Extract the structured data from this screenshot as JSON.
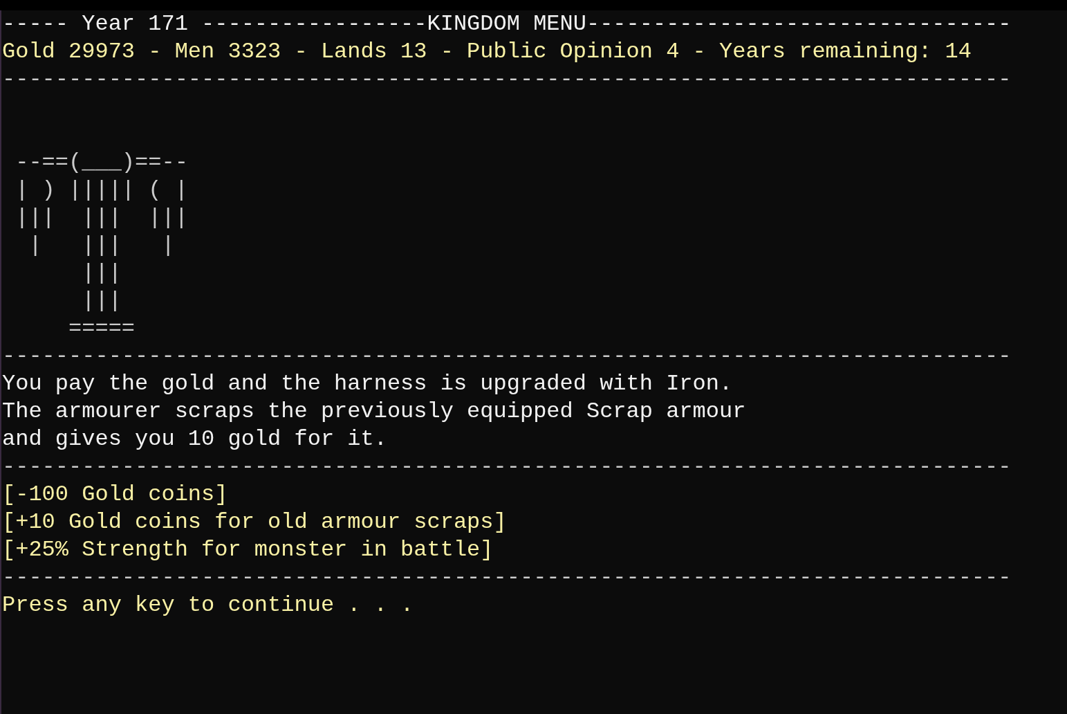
{
  "console": {
    "lines": [
      {
        "kind": "heading",
        "text": "----- Year 171 -----------------KINGDOM MENU--------------------------------"
      },
      {
        "kind": "stats",
        "text": "Gold 29973 - Men 3323 - Lands 13 - Public Opinion 4 - Years remaining: 14"
      },
      {
        "kind": "rule",
        "text": "----------------------------------------------------------------------------"
      },
      {
        "kind": "blank"
      },
      {
        "kind": "blank"
      },
      {
        "kind": "art",
        "text": " --==(___)==--"
      },
      {
        "kind": "art",
        "text": " | ) ||||| ( |"
      },
      {
        "kind": "art",
        "text": " |||  |||  |||"
      },
      {
        "kind": "art",
        "text": "  |   |||   |"
      },
      {
        "kind": "art",
        "text": "      |||"
      },
      {
        "kind": "art",
        "text": "      |||"
      },
      {
        "kind": "art",
        "text": "     ====="
      },
      {
        "kind": "rule",
        "text": "----------------------------------------------------------------------------"
      },
      {
        "kind": "message",
        "text": "You pay the gold and the harness is upgraded with Iron."
      },
      {
        "kind": "message",
        "text": "The armourer scraps the previously equipped Scrap armour"
      },
      {
        "kind": "message",
        "text": "and gives you 10 gold for it."
      },
      {
        "kind": "rule",
        "text": "----------------------------------------------------------------------------"
      },
      {
        "kind": "effect",
        "text": "[-100 Gold coins]"
      },
      {
        "kind": "effect",
        "text": "[+10 Gold coins for old armour scraps]"
      },
      {
        "kind": "effect",
        "text": "[+25% Strength for monster in battle]"
      },
      {
        "kind": "rule",
        "text": "----------------------------------------------------------------------------"
      },
      {
        "kind": "prompt",
        "text": "Press any key to continue . . ."
      }
    ]
  }
}
